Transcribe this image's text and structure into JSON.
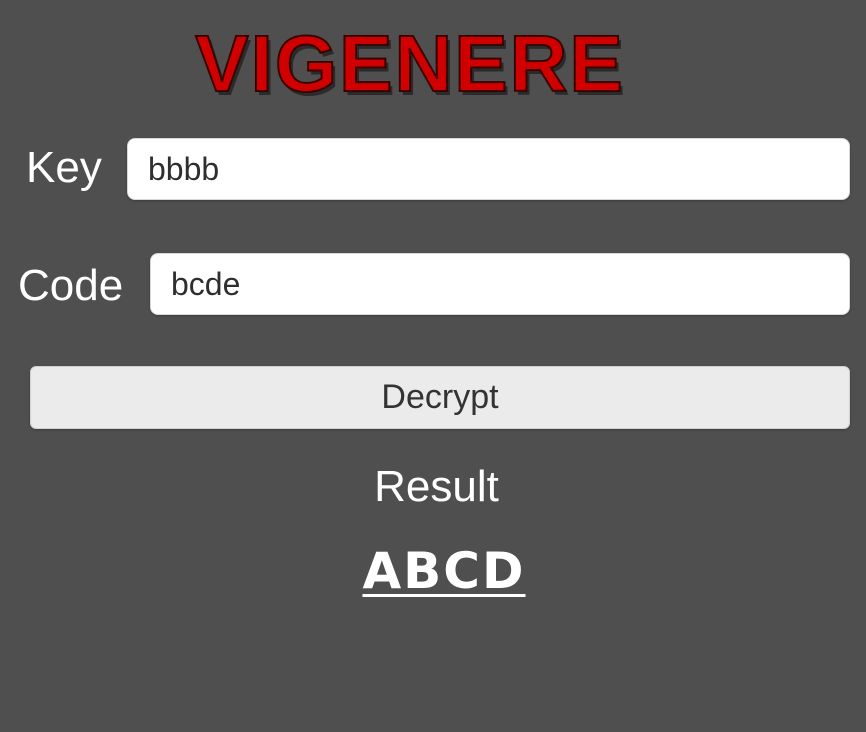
{
  "app": {
    "title": "VIGENERE"
  },
  "key_field": {
    "label": "Key",
    "value": "bbbb"
  },
  "code_field": {
    "label": "Code",
    "value": "bcde"
  },
  "decrypt_button": {
    "label": "Decrypt"
  },
  "result": {
    "label": "Result",
    "value": "ABCD"
  },
  "colors": {
    "background": "#4f4f4f",
    "title": "#d10000",
    "text": "#ffffff",
    "button": "#ebebeb"
  }
}
